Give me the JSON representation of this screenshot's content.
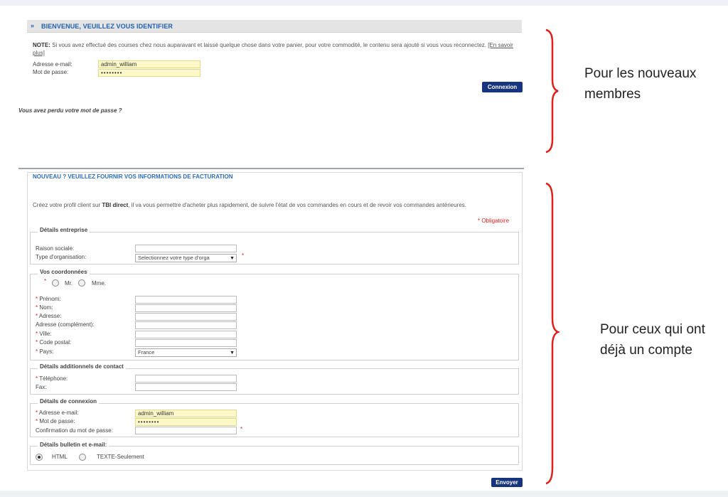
{
  "login": {
    "chevron": "»",
    "title": "BIENVENUE, VEUILLEZ VOUS IDENTIFIER",
    "note_label": "NOTE:",
    "note_text": "Si vous avez effectué des courses chez nous auparavant et laissé quelque chose dans votre panier, pour votre commodité, le contenu sera ajouté si vous vous reconnectez.",
    "note_link": "[En savoir plus]",
    "email_label": "Adresse e-mail:",
    "email_value": "admin_william",
    "password_label": "Mot de passe:",
    "password_value": "••••••••",
    "submit_label": "Connexion",
    "lost_password": "Vous avez perdu votre mot de passe ?"
  },
  "register": {
    "title": "NOUVEAU ? VEUILLEZ FOURNIR VOS INFORMATIONS DE FACTURATION",
    "intro_before": "Créez votre profil client sur ",
    "intro_brand": "TBI direct",
    "intro_after": ", il va vous permettre d'acheter plus rapidement, de suivre l'état de vos commandes en cours et de revoir vos commandes antérieures.",
    "required": "* Obligatoire",
    "company": {
      "legend": "Détails entreprise",
      "name_label": "Raison sociale:",
      "org_label": "Type d'organisation:",
      "org_value": "Selectionnez votre type d'orga"
    },
    "contact": {
      "legend": "Vos coordonnées",
      "mr": "Mr.",
      "mme": "Mme.",
      "firstname": "Prénom:",
      "lastname": "Nom:",
      "address": "Adresse:",
      "address2": "Adresse (complément):",
      "city": "Ville:",
      "zip": "Code postal:",
      "country": "Pays:",
      "country_value": "France"
    },
    "extra": {
      "legend": "Détails additionnels de contact",
      "phone": "Téléphone:",
      "fax": "Fax:"
    },
    "connection": {
      "legend": "Détails de connexion",
      "email": "Adresse e-mail:",
      "email_value": "admin_william",
      "password": "Mot de passe:",
      "password_value": "••••••••",
      "confirm": "Confirmation du mot de passe:"
    },
    "newsletter": {
      "legend": "Détails bulletin et e-mail:",
      "html": "HTML",
      "text": "TEXTE-Seulement"
    },
    "submit_label": "Envoyer"
  },
  "annotations": {
    "top_line1": "Pour les nouveaux",
    "top_line2": "membres",
    "bottom_line1": "Pour ceux qui ont",
    "bottom_line2": "déjà un compte"
  },
  "colors": {
    "brace": "#e0201c",
    "accent": "#1f5fb0",
    "button": "#17357f"
  }
}
